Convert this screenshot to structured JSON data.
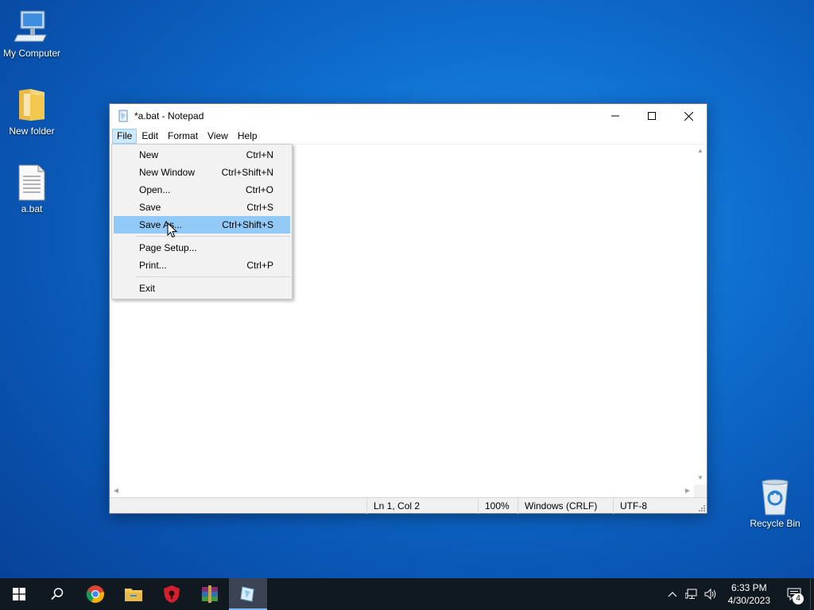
{
  "desktop": {
    "icons": [
      {
        "label": "My Computer"
      },
      {
        "label": "New folder"
      },
      {
        "label": "a.bat"
      },
      {
        "label": "Recycle Bin"
      }
    ]
  },
  "window": {
    "title": "*a.bat - Notepad",
    "menu": [
      "File",
      "Edit",
      "Format",
      "View",
      "Help"
    ],
    "status": {
      "position": "Ln 1, Col 2",
      "zoom": "100%",
      "line_ending": "Windows (CRLF)",
      "encoding": "UTF-8"
    }
  },
  "file_menu": {
    "items": [
      {
        "label": "New",
        "shortcut": "Ctrl+N"
      },
      {
        "label": "New Window",
        "shortcut": "Ctrl+Shift+N"
      },
      {
        "label": "Open...",
        "shortcut": "Ctrl+O"
      },
      {
        "label": "Save",
        "shortcut": "Ctrl+S"
      },
      {
        "label": "Save As...",
        "shortcut": "Ctrl+Shift+S"
      },
      {
        "label": "Page Setup...",
        "shortcut": ""
      },
      {
        "label": "Print...",
        "shortcut": "Ctrl+P"
      },
      {
        "label": "Exit",
        "shortcut": ""
      }
    ],
    "highlighted": "Save As..."
  },
  "taskbar": {
    "apps": [
      "start-icon",
      "search-icon",
      "chrome-icon",
      "file-explorer-icon",
      "shield-app-icon",
      "winrar-icon",
      "notepad-icon"
    ],
    "clock": {
      "time": "6:33 PM",
      "date": "4/30/2023"
    },
    "notification_count": "4"
  },
  "colors": {
    "menu_highlight": "#91c9f7",
    "menubar_active": "#cce8ff",
    "taskbar": "#101820"
  }
}
